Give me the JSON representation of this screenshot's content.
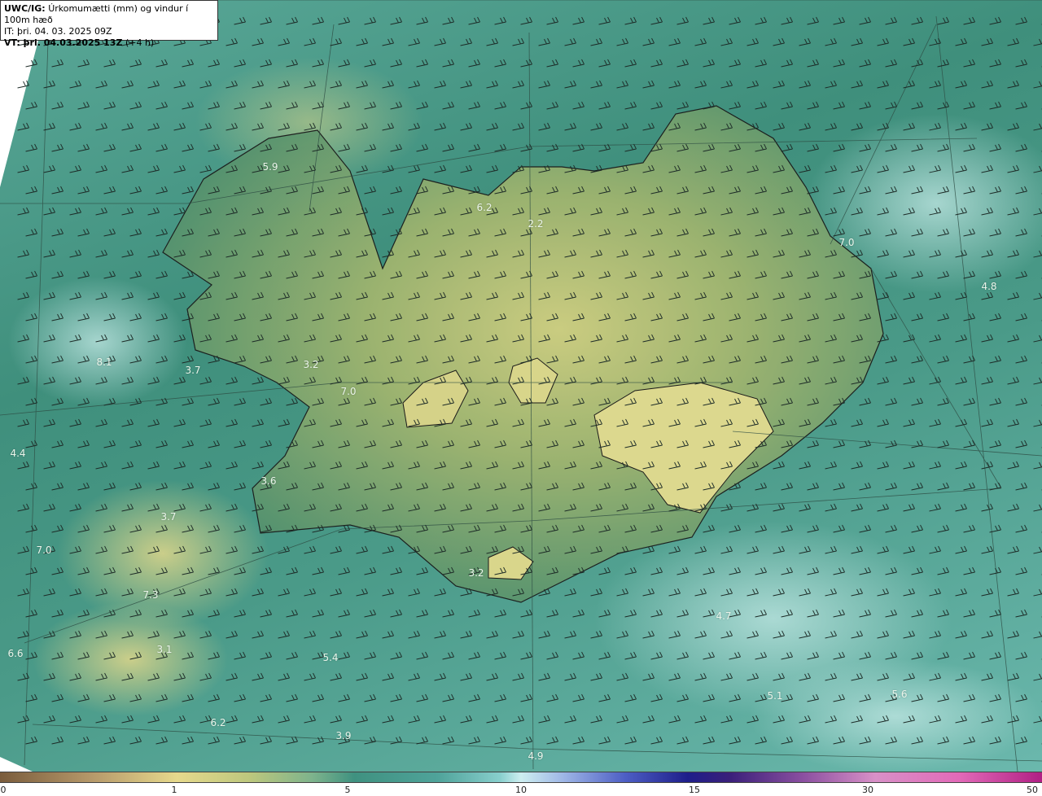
{
  "header": {
    "line1_bold": "UWC/IG:",
    "line1_text": "Úrkomumætti (mm) og vindur í 100m hæð",
    "line2": "IT: þri. 04. 03. 2025 09Z",
    "line3_bold": "VT: þri. 04.03.2025 13Z",
    "line3_text": "(+4 h)"
  },
  "map_labels": [
    "5.9",
    "6.2",
    "2.2",
    "7.0",
    "4.8",
    "8.1",
    "3.7",
    "3.2",
    "7.0",
    "4.4",
    "3.6",
    "3.7",
    "7.0",
    "7.3",
    "3.2",
    "4.7",
    "6.6",
    "3.1",
    "5.4",
    "5.1",
    "5.6",
    "6.2",
    "3.9",
    "4.9"
  ],
  "colorbar": {
    "ticks": [
      "0",
      "1",
      "5",
      "10",
      "15",
      "30",
      "50"
    ]
  },
  "colors": {
    "land_high": "#c9c97a",
    "sea": "#4a9a88",
    "coast": "#1a1a1a"
  }
}
